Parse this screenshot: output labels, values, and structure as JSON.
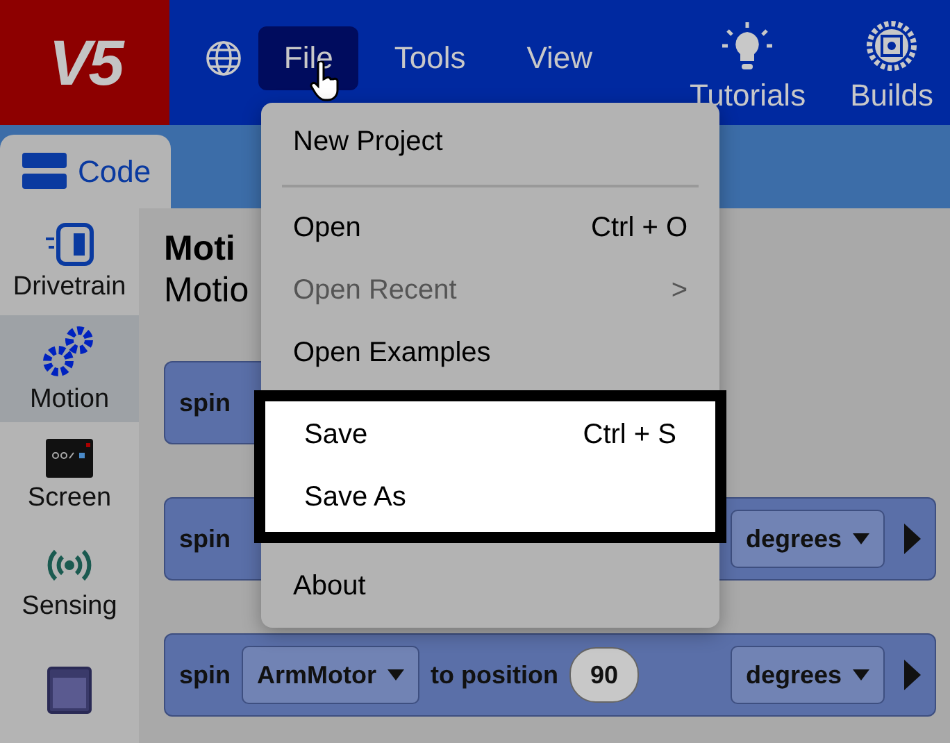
{
  "logo": "V5",
  "nav": {
    "items": [
      {
        "label": "File",
        "selected": true
      },
      {
        "label": "Tools",
        "selected": false
      },
      {
        "label": "View",
        "selected": false
      }
    ],
    "tools": [
      {
        "label": "Tutorials",
        "kind": "bulb"
      },
      {
        "label": "Builds",
        "kind": "gear"
      }
    ]
  },
  "tab": {
    "label": "Code",
    "selected": true
  },
  "categories": [
    {
      "label": "Drivetrain",
      "kind": "drivetrain",
      "selected": false
    },
    {
      "label": "Motion",
      "kind": "motion",
      "selected": true
    },
    {
      "label": "Screen",
      "kind": "screen",
      "selected": false
    },
    {
      "label": "Sensing",
      "kind": "sensing",
      "selected": false
    },
    {
      "kind": "window",
      "selected": false
    }
  ],
  "palette": {
    "title": "Moti",
    "subtitle": "Motio"
  },
  "blocks": [
    {
      "parts": [
        {
          "kind": "label",
          "text": "spin"
        }
      ]
    },
    {
      "parts": [
        {
          "kind": "label",
          "text": "spin"
        },
        {
          "kind": "dropdown",
          "text": "degrees"
        },
        {
          "kind": "run"
        }
      ]
    },
    {
      "parts": [
        {
          "kind": "label",
          "text": "spin"
        },
        {
          "kind": "dropdown",
          "text": "ArmMotor"
        },
        {
          "kind": "label",
          "text": "to position"
        },
        {
          "kind": "number",
          "text": "90"
        },
        {
          "kind": "dropdown",
          "text": "degrees"
        },
        {
          "kind": "run"
        }
      ]
    }
  ],
  "menu": {
    "groups": [
      {
        "highlighted": false,
        "items": [
          {
            "kind": "item",
            "label": "New Project",
            "disabled": false
          },
          {
            "kind": "divider"
          },
          {
            "kind": "item",
            "label": "Open",
            "shortcut": "Ctrl + O",
            "disabled": false
          },
          {
            "kind": "item",
            "label": "Open Recent",
            "shortcut": ">",
            "disabled": true
          },
          {
            "kind": "item",
            "label": "Open Examples",
            "disabled": false
          }
        ]
      },
      {
        "highlighted": true,
        "items": [
          {
            "kind": "item",
            "label": "Save",
            "shortcut": "Ctrl + S",
            "disabled": false
          },
          {
            "kind": "item",
            "label": "Save As",
            "disabled": false
          }
        ]
      },
      {
        "highlighted": false,
        "items": [
          {
            "kind": "item",
            "label": "About",
            "disabled": false
          }
        ]
      }
    ]
  }
}
